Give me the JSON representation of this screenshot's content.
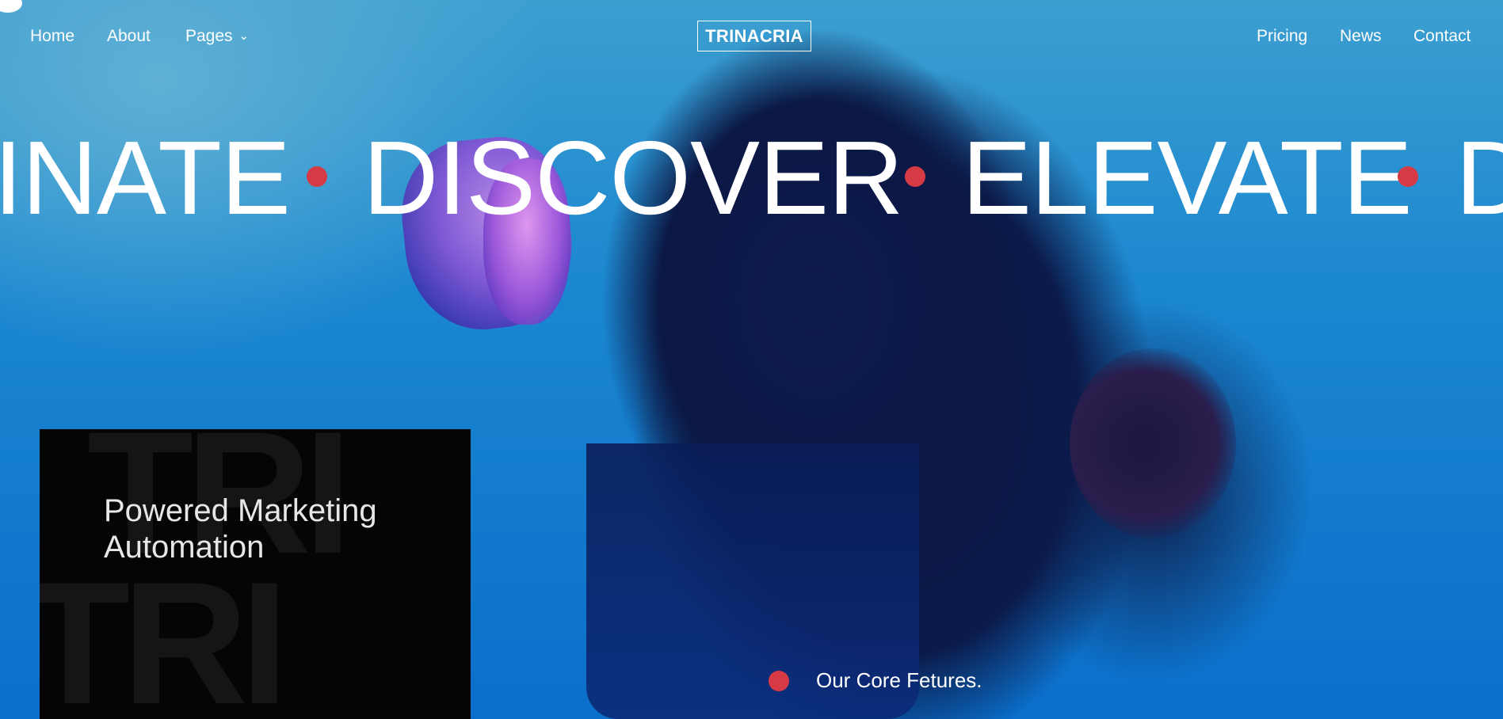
{
  "nav": {
    "home": "Home",
    "about": "About",
    "pages": "Pages",
    "pages_chevron": "⌄",
    "pricing": "Pricing",
    "news": "News",
    "contact": "Contact",
    "logo": "TRINACRIA"
  },
  "marquee": {
    "words": [
      "INATE",
      "DISCOVER",
      "ELEVATE",
      "D"
    ]
  },
  "card": {
    "watermark_top": "TRI",
    "watermark_bottom": "TRI",
    "title_line1": "Powered Marketing",
    "title_line2": "Automation"
  },
  "features": {
    "label": "Our Core Fetures."
  },
  "colors": {
    "accent_dot": "#d63a44",
    "card_bg": "#050505",
    "sky_blue": "#1b87d0"
  }
}
